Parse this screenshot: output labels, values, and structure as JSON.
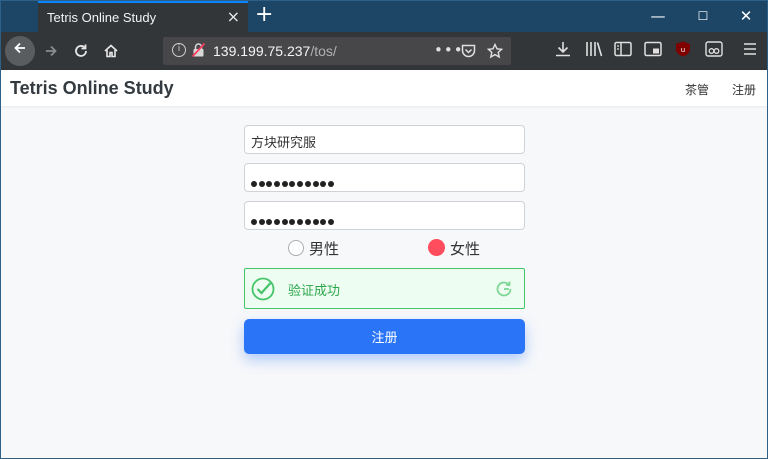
{
  "browser": {
    "tab_title": "Tetris Online Study",
    "tab_close": "×",
    "new_tab": "+",
    "url_host": "139.199.75.237",
    "url_path": "/tos/",
    "window_controls": {
      "minimize": "—",
      "maximize": "☐",
      "close": "✕"
    }
  },
  "app": {
    "brand": "Tetris Online Study",
    "nav": [
      "茶管",
      "注册"
    ]
  },
  "form": {
    "username_value": "方块研究服",
    "password_mask_count": 11,
    "confirm_mask_count": 11,
    "gender": {
      "options": [
        "男性",
        "女性"
      ],
      "selected": "女性"
    },
    "verify": {
      "status_text": "验证成功",
      "success_color": "#2ca64b"
    },
    "submit_label": "注册"
  },
  "colors": {
    "accent": "#2a75f7",
    "radio_selected": "#ff4d5e",
    "tabbar": "#1c4566"
  },
  "icons": [
    "back-icon",
    "forward-icon",
    "reload-icon",
    "home-icon",
    "info-icon",
    "insecure-lock-icon",
    "more-icon",
    "pocket-icon",
    "bookmark-star-icon",
    "download-icon",
    "library-icon",
    "sidebar-icon",
    "screenshot-icon",
    "ublock-icon",
    "reader-icon",
    "menu-icon",
    "checkmark-icon",
    "refresh-icon"
  ]
}
